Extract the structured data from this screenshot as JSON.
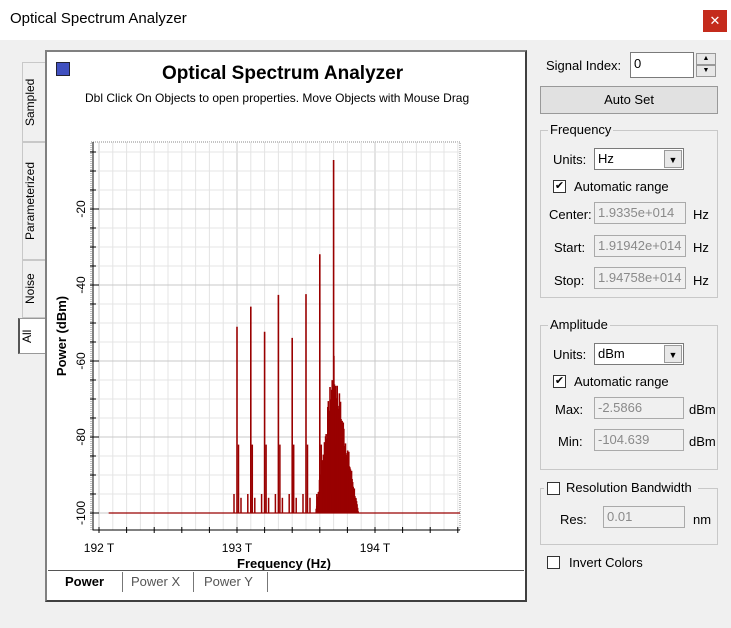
{
  "window": {
    "title": "Optical Spectrum Analyzer",
    "close": "✕"
  },
  "side_tabs": [
    "Sampled",
    "Parameterized",
    "Noise",
    "All"
  ],
  "chart_header": {
    "title": "Optical Spectrum Analyzer",
    "hint": "Dbl Click On Objects to open properties.  Move Objects with Mouse Drag"
  },
  "bottom_tabs": [
    "Power",
    "Power X",
    "Power Y"
  ],
  "controls": {
    "signal_index_label": "Signal Index:",
    "signal_index": "0",
    "auto_set": "Auto Set",
    "frequency": {
      "title": "Frequency",
      "units_label": "Units:",
      "units": "Hz",
      "auto_label": "Automatic range",
      "auto": true,
      "center_label": "Center:",
      "center": "1.9335e+014",
      "start_label": "Start:",
      "start": "1.91942e+014",
      "stop_label": "Stop:",
      "stop": "1.94758e+014",
      "unit": "Hz"
    },
    "amplitude": {
      "title": "Amplitude",
      "units_label": "Units:",
      "units": "dBm",
      "auto_label": "Automatic range",
      "auto": true,
      "max_label": "Max:",
      "max": "-2.5866",
      "min_label": "Min:",
      "min": "-104.639",
      "unit": "dBm"
    },
    "resolution": {
      "title": "Resolution Bandwidth",
      "checked": false,
      "res_label": "Res:",
      "res": "0.01",
      "unit": "nm"
    },
    "invert_label": "Invert Colors"
  },
  "chart_data": {
    "type": "line",
    "xlabel": "Frequency (Hz)",
    "ylabel": "Power (dBm)",
    "xlim": [
      191.94,
      194.62
    ],
    "ylim": [
      -104.639,
      -2.5866
    ],
    "xticks": [
      192,
      193,
      194
    ],
    "xtick_labels": [
      "192 T",
      "193 T",
      "194 T"
    ],
    "yticks": [
      -20,
      -40,
      -60,
      -80,
      -100
    ],
    "ytick_labels": [
      "-20",
      "-40",
      "-60",
      "-80",
      "-100"
    ],
    "grid": true,
    "color": "#990000",
    "noise_floor": -100,
    "trace_range_THz": [
      192.07,
      194.62
    ],
    "peaks": [
      {
        "x": 193.0,
        "y": -51
      },
      {
        "x": 193.1,
        "y": -45.7
      },
      {
        "x": 193.2,
        "y": -52.3
      },
      {
        "x": 193.3,
        "y": -42.6
      },
      {
        "x": 193.4,
        "y": -53.9
      },
      {
        "x": 193.5,
        "y": -42.4
      },
      {
        "x": 193.6,
        "y": -31.9
      },
      {
        "x": 193.7,
        "y": -7.1
      }
    ],
    "cluster": {
      "from": 193.57,
      "to": 193.88,
      "peak_x": 193.7,
      "peak_y": -58
    }
  }
}
